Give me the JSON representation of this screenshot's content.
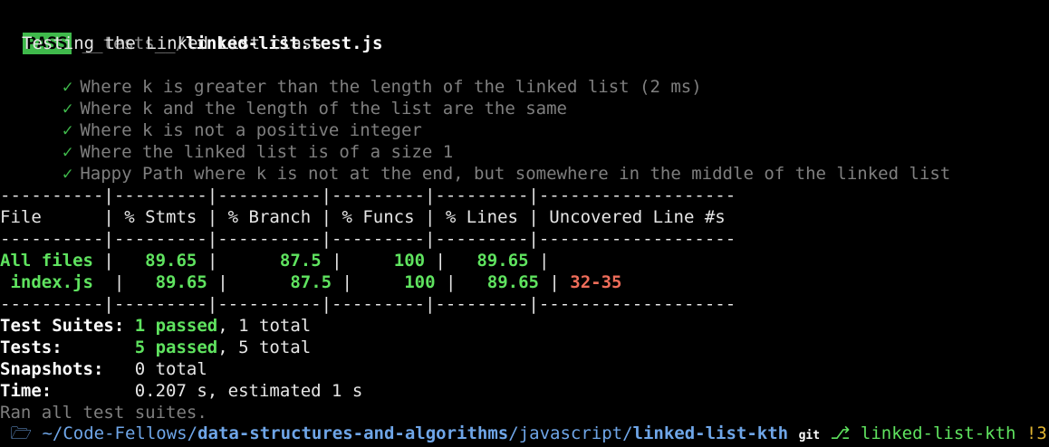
{
  "header": {
    "badge": "PASS",
    "path_dim": "__tests__/",
    "file": "linked-list.test.js"
  },
  "suite": {
    "title": "Testing the Linked List class",
    "check_glyph": "✓",
    "tests": [
      "Where k is greater than the length of the linked list (2 ms)",
      "Where k and the length of the list are the same",
      "Where k is not a positive integer",
      "Where the linked list is of a size 1",
      "Happy Path where k is not at the end, but somewhere in the middle of the linked list"
    ]
  },
  "coverage": {
    "separator": "----------|---------|----------|---------|---------|-------------------",
    "header": "File      | % Stmts | % Branch | % Funcs | % Lines | Uncovered Line #s ",
    "rows": [
      {
        "file": "All files",
        "stmts": "89.65",
        "branch": "87.5",
        "funcs": "100",
        "lines": "89.65",
        "uncovered": ""
      },
      {
        "file": " index.js",
        "stmts": "89.65",
        "branch": "87.5",
        "funcs": "100",
        "lines": "89.65",
        "uncovered": "32-35"
      }
    ]
  },
  "summary": {
    "suites_label": "Test Suites:",
    "suites_passed": "1 passed",
    "suites_total": ", 1 total",
    "tests_label": "Tests:",
    "tests_passed": "5 passed",
    "tests_total": ", 5 total",
    "snapshots_label": "Snapshots:",
    "snapshots_value": "0 total",
    "time_label": "Time:",
    "time_value": "0.207 s, estimated 1 s",
    "ran": "Ran all test suites."
  },
  "prompt": {
    "apple": "",
    "folder": "🗁",
    "path_home": "~/Code-Fellows/",
    "path_bold": "data-structures-and-algorithms",
    "path_sep1": "/",
    "path_js": "javascript",
    "path_sep2": "/",
    "path_dir": "linked-list-kth",
    "git_label": "git",
    "branch_icon": "⎇",
    "branch": "linked-list-kth",
    "status": "!3"
  },
  "colors": {
    "background": "#000000",
    "pass_badge": "#3fb94b",
    "coverage_good": "#5fe35f",
    "uncovered": "#ee6d5a",
    "path_blue": "#6fa6e8",
    "git_status": "#e0b431"
  }
}
